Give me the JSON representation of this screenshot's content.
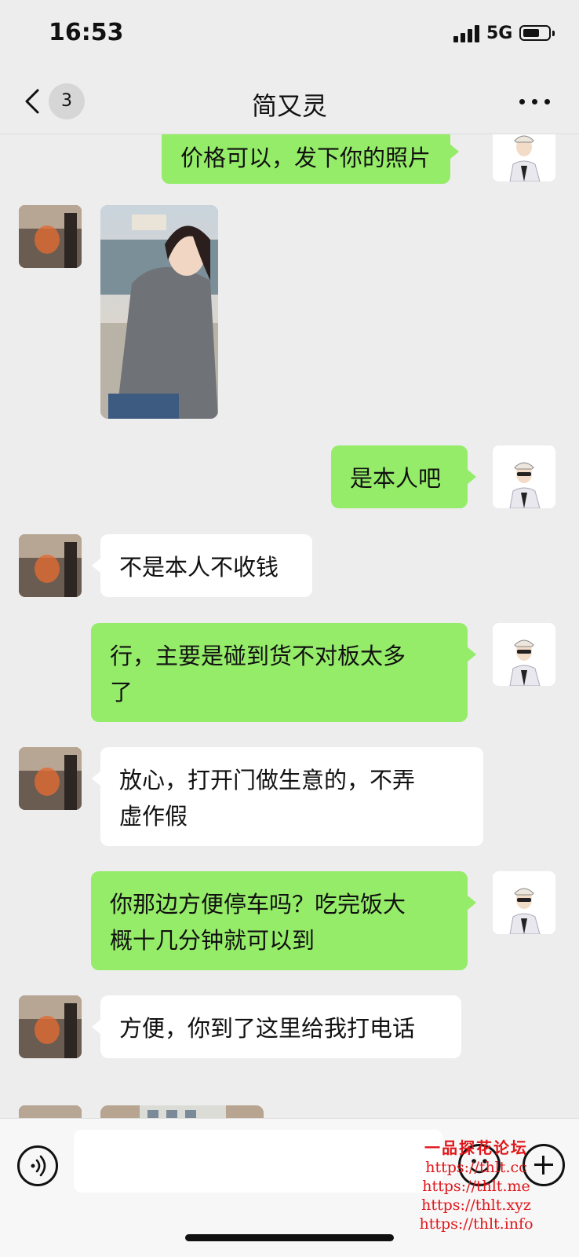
{
  "status_bar": {
    "time": "16:53",
    "network": "5G",
    "signal_icon": "signal-bars-icon",
    "battery_icon": "battery-icon"
  },
  "nav": {
    "back_icon": "chevron-left-icon",
    "unread_count": "3",
    "title": "简又灵",
    "more_icon": "more-dots-icon"
  },
  "messages": [
    {
      "from": "me",
      "type": "text",
      "text": "价格可以，发下你的照片"
    },
    {
      "from": "contact",
      "type": "image"
    },
    {
      "from": "me",
      "type": "text",
      "text": "是本人吧"
    },
    {
      "from": "contact",
      "type": "text",
      "text": "不是本人不收钱"
    },
    {
      "from": "me",
      "type": "text",
      "line1": "行，主要是碰到货不对板太多",
      "line2": "了"
    },
    {
      "from": "contact",
      "type": "text",
      "line1": "放心，打开门做生意的，不弄",
      "line2": "虚作假"
    },
    {
      "from": "me",
      "type": "text",
      "line1": "你那边方便停车吗？吃完饭大",
      "line2": "概十几分钟就可以到"
    },
    {
      "from": "contact",
      "type": "text",
      "text": "方便，你到了这里给我打电话"
    },
    {
      "from": "contact",
      "type": "image"
    }
  ],
  "input_bar": {
    "voice_icon": "voice-icon",
    "emoji_icon": "emoji-icon",
    "plus_icon": "plus-icon",
    "input_value": ""
  },
  "watermark": {
    "title": "一品探花论坛",
    "lines": [
      "https://thlt.cc",
      "https://thlt.me",
      "https://thlt.xyz",
      "https://thlt.info"
    ]
  },
  "colors": {
    "background": "#ededed",
    "outgoing_bubble": "#95ec69",
    "incoming_bubble": "#ffffff",
    "watermark": "#e1161a"
  }
}
